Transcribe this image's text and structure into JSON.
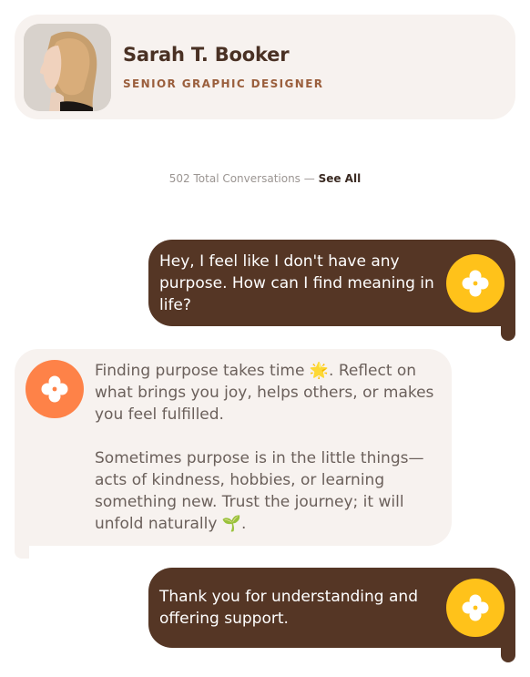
{
  "profile": {
    "name": "Sarah T. Booker",
    "role": "SENIOR GRAPHIC DESIGNER"
  },
  "conversations": {
    "count_text": "502 Total Conversations —",
    "see_all_label": "See All"
  },
  "messages": [
    {
      "sender": "user",
      "text": "Hey, I feel like I don't have any purpose. How can I find meaning in life?"
    },
    {
      "sender": "assistant",
      "paragraphs": [
        "Finding purpose takes time 🌟. Reflect on what brings you joy, helps others, or makes you feel fulfilled.",
        "Sometimes purpose is in the little things—acts of kindness, hobbies, or learning something new. Trust the journey; it will unfold naturally 🌱."
      ]
    },
    {
      "sender": "user",
      "text": "Thank you for understanding and offering support."
    }
  ],
  "icons": {
    "user_bubble_icon": "flower-icon",
    "assistant_bubble_icon": "flower-icon"
  },
  "colors": {
    "user_bubble": "#553625",
    "assistant_bubble": "#f7f2ef",
    "user_icon_bg": "#ffc21a",
    "assistant_icon_bg": "#fe8248",
    "name_text": "#4a3124",
    "role_text": "#9a5e3c"
  }
}
